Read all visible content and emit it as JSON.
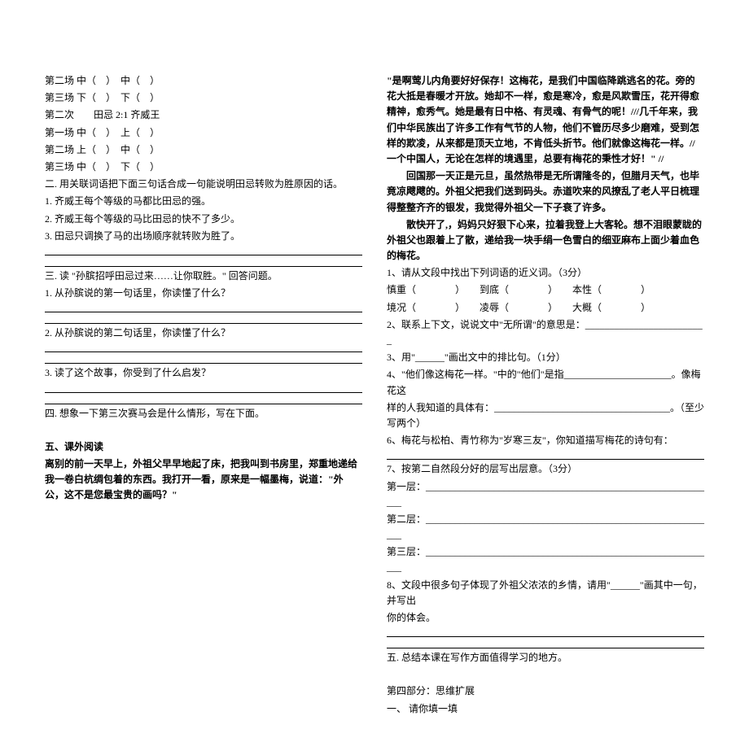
{
  "left": {
    "lines": [
      "第二场 中（　）　中（　）",
      "第三场 下（　）　下（　）",
      "第二次　　田忌 2:1 齐威王",
      "第一场 中（　）　上（　）",
      "第二场 上（　）　中（　）",
      "第三场 中（　）　下（　）"
    ],
    "sec2_title": "二. 用关联词语把下面三句话合成一句能说明田忌转败为胜原因的话。",
    "sec2_items": [
      "1. 齐威王每个等级的马都比田忌的强。",
      "2. 齐威王每个等级的马比田忌的快不了多少。",
      "3. 田忌只调换了马的出场顺序就转败为胜了。"
    ],
    "sec3_title": "三. 读 \"孙膑招呼田忌过来……让你取胜。\" 回答问题。",
    "sec3_q1": "1. 从孙膑说的第一句话里，你读懂了什么？",
    "sec3_q2": "2. 从孙膑说的第二句话里，你读懂了什么？",
    "sec3_q3": "3. 读了这个故事，你受到了什么启发？",
    "sec4_title": "四. 想象一下第三次赛马会是什么情形，写在下面。",
    "sec5_title": "五、课外阅读",
    "passage1": "离别的前一天早上，外祖父早早地起了床，把我叫到书房里，郑重地递给我一卷白杭绸包着的东西。我打开一看，原来是一幅墨梅，说道：\"外公，这不是您最宝贵的画吗？\""
  },
  "right": {
    "passage_p1": "\"是啊莺儿内角要好好保存！这梅花，是我们中国临降跳逃名的花。旁的花大抵是春暖才开放。她却不一样，愈是寒冷，愈是风欺雪压，花开得愈精神，愈秀气。她是最有日中格、有灵魂、有骨气的呢！///几千年来，我们中华民族出了许多工作有气节的人物，他们不管历尽多少磨难，受到怎样的欺凌，从来都是顶天立地，不肯低头折节。他们就像这梅花一样。//一个中国人，无论在怎样的境遇里，总要有梅花的秉性才好！\" //",
    "passage_p2": "　　回国那一天正是元旦，虽然热带是无所谓隆冬的，但腊月天气，也毕竟凉飕飕的。外祖父把我们送到码头。赤道吹来的风撩乱了老人平日梳理得整整齐齐的银发，我觉得外祖父一下子衰了许多。",
    "passage_p3": "　　散快开了,，妈妈只好狠下心来，拉着我登上大客轮。想不泪眼蒙眬的外祖父也跟着上了散，递给我一块手绢一色雪白的细亚麻布上面少着血色的梅花。",
    "q1_title": "1、请从文段中找出下列词语的近义词。（3分）",
    "q1_row1": "慎重（　　　　）　　到底（　　　　）　　本性（　　　　）",
    "q1_row2": "境况（　　　　）　　凌辱（　　　　）　　大概（　　　　）",
    "q2": "2、联系上下文，说说文中\"无所谓\"的意思是：_________________________",
    "q3": "3、用\"______\"画出文中的排比句。（1分）",
    "q4_a": "4、\"他们像这梅花一样。\"中的\"他们\"是指______________________。像梅花这",
    "q4_b": "样的人我知道的具体有：____________________________________。（至少写两个）",
    "q6": "6、梅花与松柏、青竹称为\"岁寒三友\"，你知道描写梅花的诗句有：",
    "q7_title": "7、按第二自然段分好的层写出层意。（3分）",
    "q7_l1": "第一层：____________________________________________________________",
    "q7_l2": "第二层：____________________________________________________________",
    "q7_l3": "第三层：____________________________________________________________",
    "q8_a": "8、文段中很多句子体现了外祖父浓浓的乡情，请用\"______\"画其中一句，并写出",
    "q8_b": "你的体会。",
    "sec5b": "五. 总结本课在写作方面值得学习的地方。",
    "part4": "第四部分：思维扩展",
    "part4_1": "一、 请你填一填"
  }
}
